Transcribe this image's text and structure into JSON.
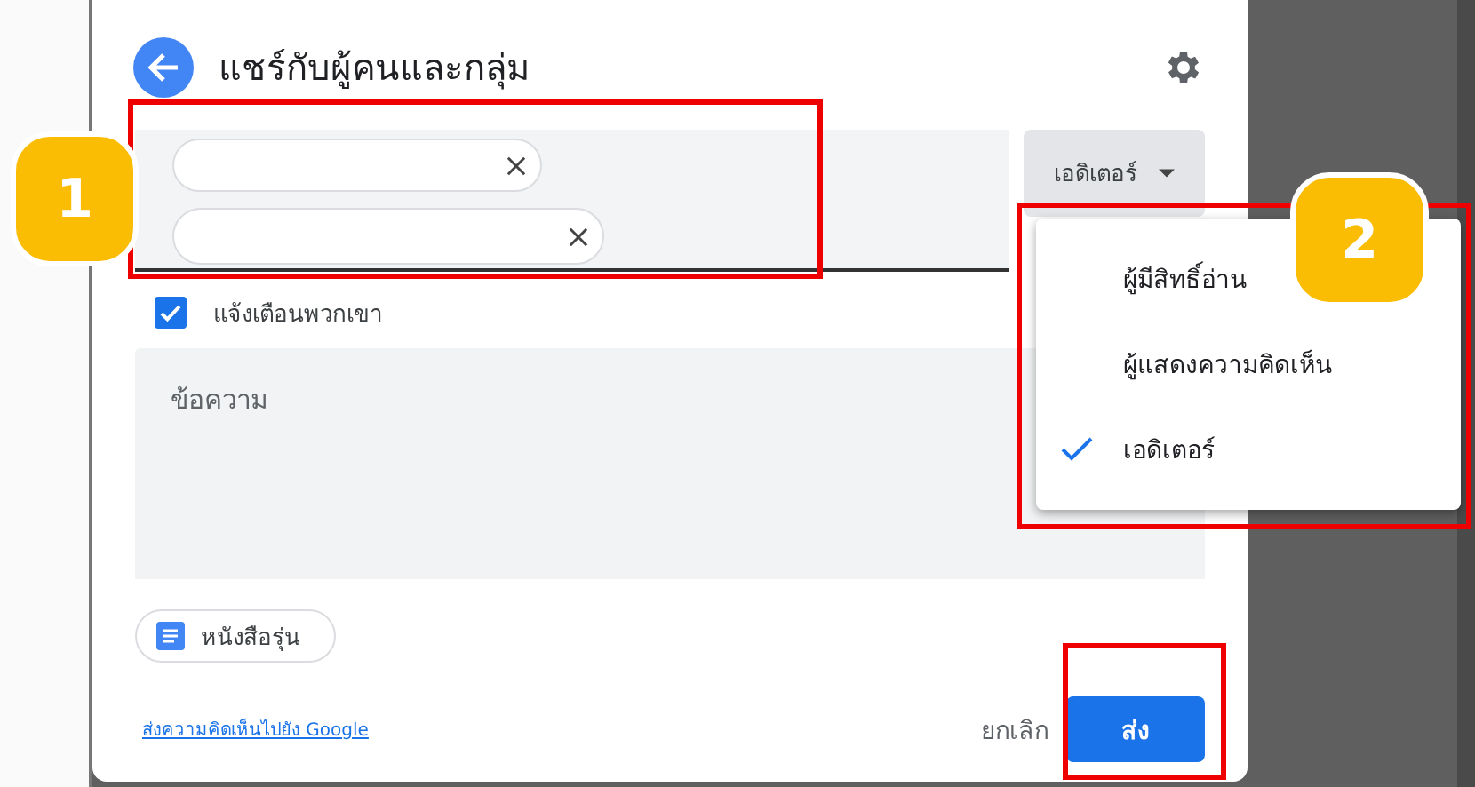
{
  "dialog": {
    "title": "แชร์กับผู้คนและกลุ่ม",
    "recipients": [
      {
        "redacted": true
      },
      {
        "redacted": true
      }
    ],
    "role_button": {
      "label": "เอดิเตอร์",
      "expanded": true
    },
    "notify": {
      "label": "แจ้งเตือนพวกเขา",
      "checked": true
    },
    "message": {
      "placeholder": "ข้อความ"
    },
    "attachment_chip": {
      "label": "หนังสือรุ่น"
    },
    "feedback_link": "ส่งความคิดเห็นไปยัง Google",
    "buttons": [
      {
        "label": "ยกเลิก",
        "kind": "text"
      },
      {
        "label": "ส่ง",
        "kind": "primary"
      }
    ]
  },
  "role_menu": {
    "items": [
      {
        "label": "ผู้มีสิทธิ์อ่าน",
        "selected": false
      },
      {
        "label": "ผู้แสดงความคิดเห็น",
        "selected": false
      },
      {
        "label": "เอดิเตอร์",
        "selected": true
      }
    ]
  },
  "highlights": [
    {
      "kind": "frame"
    },
    {
      "kind": "frame"
    },
    {
      "kind": "frame"
    }
  ],
  "callouts": [
    {
      "label": "1"
    },
    {
      "label": "2"
    }
  ]
}
